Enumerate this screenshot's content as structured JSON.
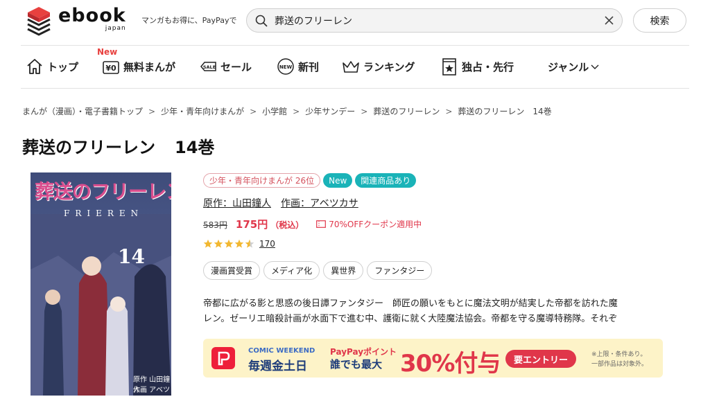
{
  "header": {
    "logo_word": "ebook",
    "logo_sub": "japan",
    "tagline": "マンガもお得に、PayPayで",
    "search_value": "葬送のフリーレン",
    "search_button": "検索"
  },
  "nav": {
    "items": [
      {
        "label": "トップ",
        "icon": "home-icon"
      },
      {
        "label": "無料まんが",
        "icon": "yen-zero-icon",
        "badge": "New"
      },
      {
        "label": "セール",
        "icon": "sale-tag-icon"
      },
      {
        "label": "新刊",
        "icon": "new-badge-icon"
      },
      {
        "label": "ランキング",
        "icon": "crown-icon"
      },
      {
        "label": "独占・先行",
        "icon": "star-book-icon"
      },
      {
        "label": "ジャンル",
        "icon": "chevron-down-icon"
      }
    ]
  },
  "breadcrumb": [
    "まんが（漫画）・電子書籍トップ",
    "少年・青年向けまんが",
    "小学館",
    "少年サンデー",
    "葬送のフリーレン",
    "葬送のフリーレン　14巻"
  ],
  "breadcrumb_sep": ">",
  "product": {
    "title": "葬送のフリーレン",
    "volume": "14巻",
    "cover": {
      "title": "葬送のフリーレン",
      "roman": "FRIEREN",
      "volume": "14",
      "credit1": "原作 山田鐘人",
      "credit2": "作画 アベツカサ"
    },
    "rank_badge": "少年・青年向けまんが 26位",
    "new_badge": "New",
    "related_badge": "関連商品あり",
    "author": "原作：山田鐘人",
    "illustrator": "作画：アベツカサ",
    "old_price": "583円",
    "price": "175円",
    "tax": "（税込）",
    "coupon": "70%OFFクーポン適用中",
    "rating": 4.5,
    "rating_count": "170",
    "tags": [
      "漫画賞受賞",
      "メディア化",
      "異世界",
      "ファンタジー"
    ],
    "description_line1": "帝都に広がる影と思惑の後日譚ファンタジー　師匠の願いをもとに魔法文明が結実した帝都を訪れた魔",
    "description_line2": "レン。ゼーリエ暗殺計画が水面下で進む中、護衛に就く大陸魔法協会。帝都を守る魔導特務隊。それぞ"
  },
  "banner": {
    "label_cw": "COMIC WEEKEND",
    "days": "毎週金土日",
    "paypay": "PayPayポイント",
    "anyone": "誰でも最大",
    "percent": "30%付与",
    "entry": "要エントリー",
    "note1": "※上限・条件あり。",
    "note2": "一部作品は対象外。"
  },
  "colors": {
    "accent_red": "#e0364a",
    "teal": "#1ab3b8",
    "logo_red": "#e8413f"
  }
}
